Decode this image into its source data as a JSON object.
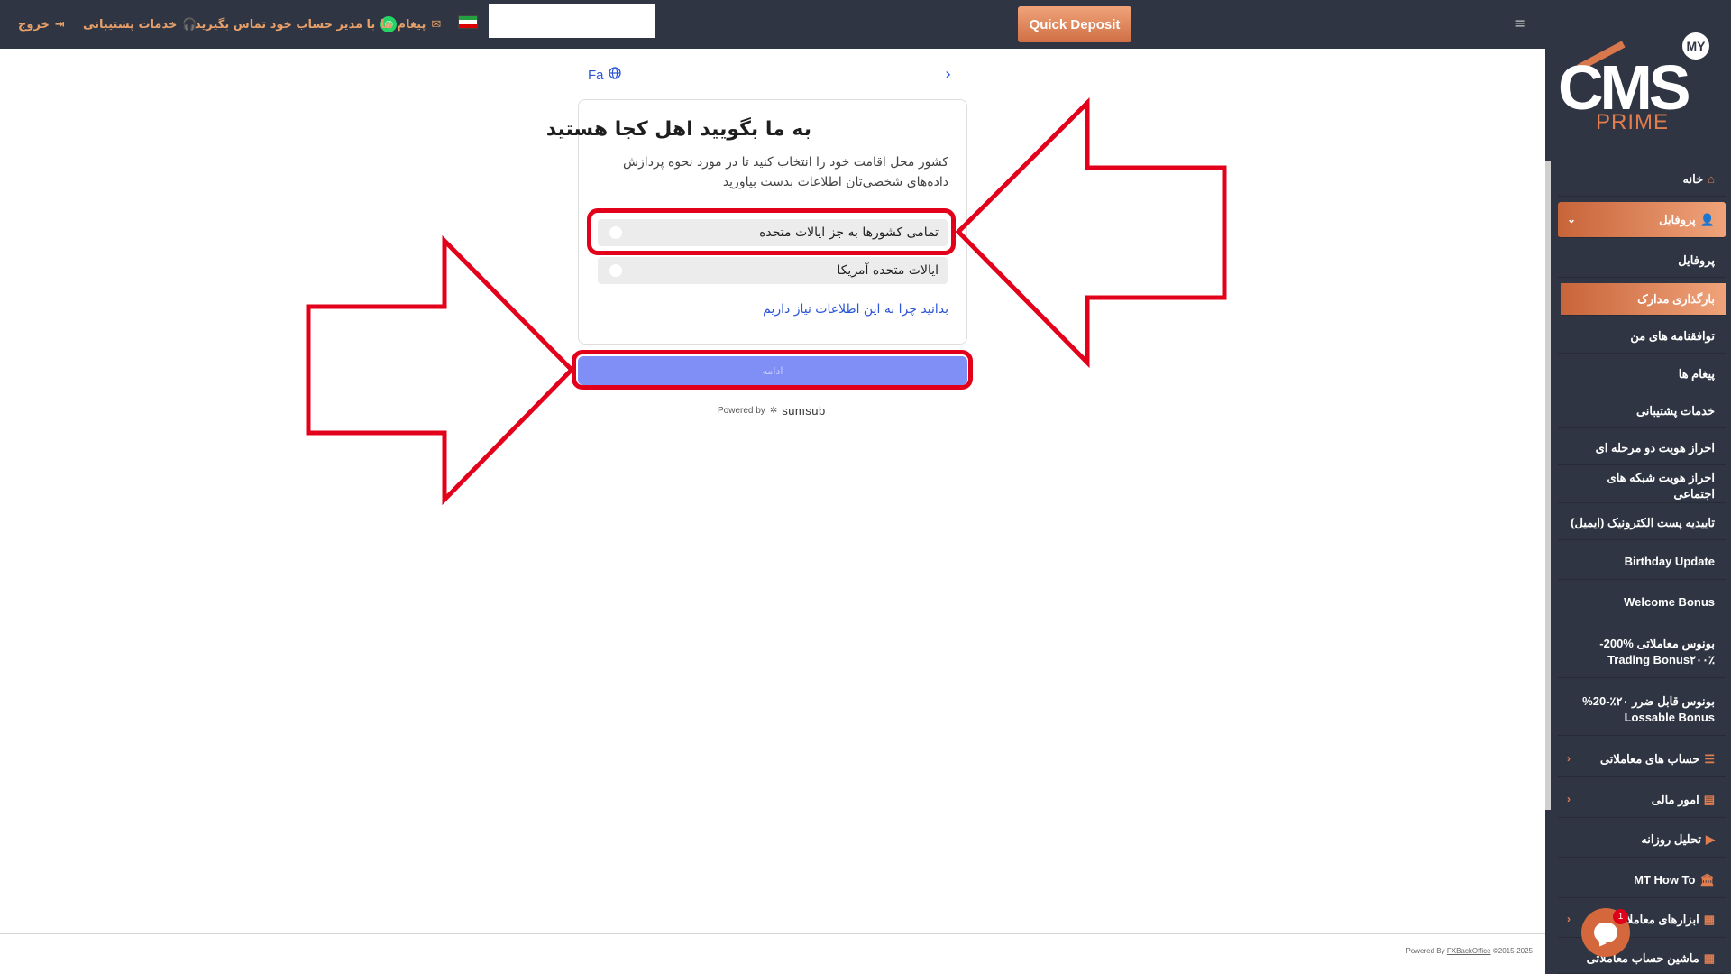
{
  "topbar": {
    "logout": "خروج",
    "support": "خدمات پشتیبانی",
    "contact_manager": "با مدیر حساب خود تماس بگیرید",
    "messages": "پیغام ها",
    "search_value": "",
    "quick_deposit": "Quick Deposit",
    "hamburger_icon": "≡"
  },
  "logo": {
    "brand": "CMS",
    "badge": "MY",
    "sub": "PRIME"
  },
  "sidebar": {
    "items": [
      {
        "label": "خانه",
        "icon": "home-icon",
        "glyph": "⌂"
      },
      {
        "label": "پروفایل",
        "icon": "user-icon",
        "glyph": "👤",
        "active": true,
        "chevron": "⌄"
      },
      {
        "label": "پروفایل"
      },
      {
        "label": "بارگذاری مدارک",
        "active": true
      },
      {
        "label": "توافقنامه های من"
      },
      {
        "label": "پیغام ها"
      },
      {
        "label": "خدمات پشتیبانی"
      },
      {
        "label": "احراز هویت دو مرحله ای"
      },
      {
        "label": "احراز هویت شبکه های اجتماعی"
      },
      {
        "label": "تاییدیه پست الکترونیک (ایمیل)"
      },
      {
        "label": "Birthday Update"
      },
      {
        "label": "Welcome Bonus"
      },
      {
        "label": "بونوس معاملاتی ‎-200%‎ Trading Bonus۲۰۰٪‏"
      },
      {
        "label": "بونوس قابل ضرر ۲۰٪-20%‎ Lossable Bonus"
      },
      {
        "label": "حساب های معاملاتی",
        "glyph": "☰",
        "chevron": "‹"
      },
      {
        "label": "امور مالی",
        "glyph": "▤",
        "chevron": "‹"
      },
      {
        "label": "تحلیل روزانه",
        "glyph": "▶"
      },
      {
        "label": "MT How To",
        "glyph": "🏛"
      },
      {
        "label": "ابزارهای معاملاتی",
        "glyph": "▦",
        "chevron": "‹"
      },
      {
        "label": "ماشین حساب معاملاتی",
        "glyph": "▦"
      }
    ]
  },
  "main": {
    "lang": "Fa",
    "back_arrow": "›",
    "title": "به ما بگویید اهل کجا هستید",
    "description": "کشور محل اقامت خود را انتخاب کنید تا در مورد نحوه پردازش داده‌های شخصی‌تان اطلاعات بدست بیاورید",
    "options": [
      {
        "label": "تمامی کشورها به جز ایالات متحده"
      },
      {
        "label": "ایالات متحده آمریکا"
      }
    ],
    "why_link": "بدانید چرا به این اطلاعات نیاز داریم",
    "continue": "ادامه",
    "powered_by": "Powered by",
    "powered_brand": "sumsub"
  },
  "footer": {
    "powered": "Powered By",
    "link": "FXBackOffice",
    "copyright": "©2015-2025"
  },
  "chat": {
    "badge": "1"
  },
  "colors": {
    "dark": "#2f3542",
    "accent": "#e37d4e",
    "highlight": "#e3001b",
    "button": "#7f8ff6",
    "link": "#2b55d6"
  }
}
